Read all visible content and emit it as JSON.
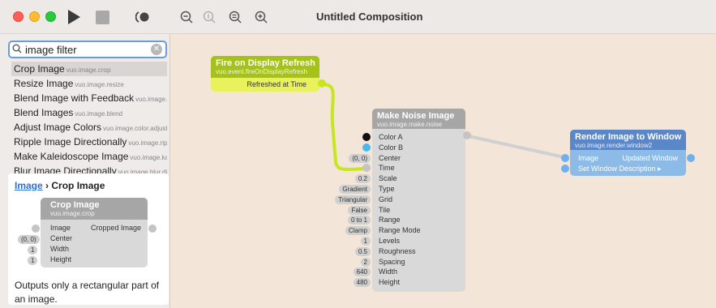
{
  "window": {
    "title": "Untitled Composition"
  },
  "toolbar": {
    "run": "play-icon",
    "stop": "stop-icon",
    "zoom_out": "zoom-out-icon",
    "zoom_actual": "zoom-actual-icon",
    "zoom_fit": "zoom-fit-icon",
    "zoom_in": "zoom-in-icon"
  },
  "library": {
    "search_value": "image filter",
    "results": [
      {
        "title": "Crop Image",
        "id": "vuo.image.crop"
      },
      {
        "title": "Resize Image",
        "id": "vuo.image.resize"
      },
      {
        "title": "Blend Image with Feedback",
        "id": "vuo.image.feedback"
      },
      {
        "title": "Blend Images",
        "id": "vuo.image.blend"
      },
      {
        "title": "Adjust Image Colors",
        "id": "vuo.image.color.adjust"
      },
      {
        "title": "Ripple Image Directionally",
        "id": "vuo.image.ripple"
      },
      {
        "title": "Make Kaleidoscope Image",
        "id": "vuo.image.kaleidoscope"
      },
      {
        "title": "Blur Image Directionally",
        "id": "vuo.image.blur.directional"
      }
    ],
    "detail": {
      "breadcrumb_link": "Image",
      "breadcrumb_sep": " › ",
      "breadcrumb_current": "Crop Image",
      "node_title": "Crop Image",
      "node_class": "vuo.image.crop",
      "inputs": [
        {
          "label": "Image",
          "const": ""
        },
        {
          "label": "Center",
          "const": "(0, 0)"
        },
        {
          "label": "Width",
          "const": "1"
        },
        {
          "label": "Height",
          "const": "1"
        }
      ],
      "output": "Cropped Image",
      "description": "Outputs only a rectangular part of an image."
    }
  },
  "nodes": {
    "fire": {
      "title": "Fire on Display Refresh",
      "cls": "vuo.event.fireOnDisplayRefresh",
      "output": "Refreshed at Time"
    },
    "noise": {
      "title": "Make Noise Image",
      "cls": "vuo.image.make.noise",
      "inputs": [
        {
          "label": "Color A",
          "const": ""
        },
        {
          "label": "Color B",
          "const": ""
        },
        {
          "label": "Center",
          "const": "(0, 0)"
        },
        {
          "label": "Time",
          "const": ""
        },
        {
          "label": "Scale",
          "const": "0.2"
        },
        {
          "label": "Type",
          "const": "Gradient"
        },
        {
          "label": "Grid",
          "const": "Triangular"
        },
        {
          "label": "Tile",
          "const": "False"
        },
        {
          "label": "Range",
          "const": "0 to 1"
        },
        {
          "label": "Range Mode",
          "const": "Clamp"
        },
        {
          "label": "Levels",
          "const": "1"
        },
        {
          "label": "Roughness",
          "const": "0.5"
        },
        {
          "label": "Spacing",
          "const": "2"
        },
        {
          "label": "Width",
          "const": "640"
        },
        {
          "label": "Height",
          "const": "480"
        }
      ],
      "color_a": "#111111",
      "color_b": "#49b7f0"
    },
    "render": {
      "title": "Render Image to Window",
      "cls": "vuo.image.render.window2",
      "input_image": "Image",
      "input_desc": "Set Window Description ▸",
      "output": "Updated Window"
    }
  },
  "colors": {
    "fire_head": "#a4c21a",
    "fire_body": "#e9f25c",
    "render_head": "#5a87c7",
    "render_body": "#8dbbe8",
    "cable_event": "#c8e61e",
    "cable_image": "#d4d4d4"
  }
}
